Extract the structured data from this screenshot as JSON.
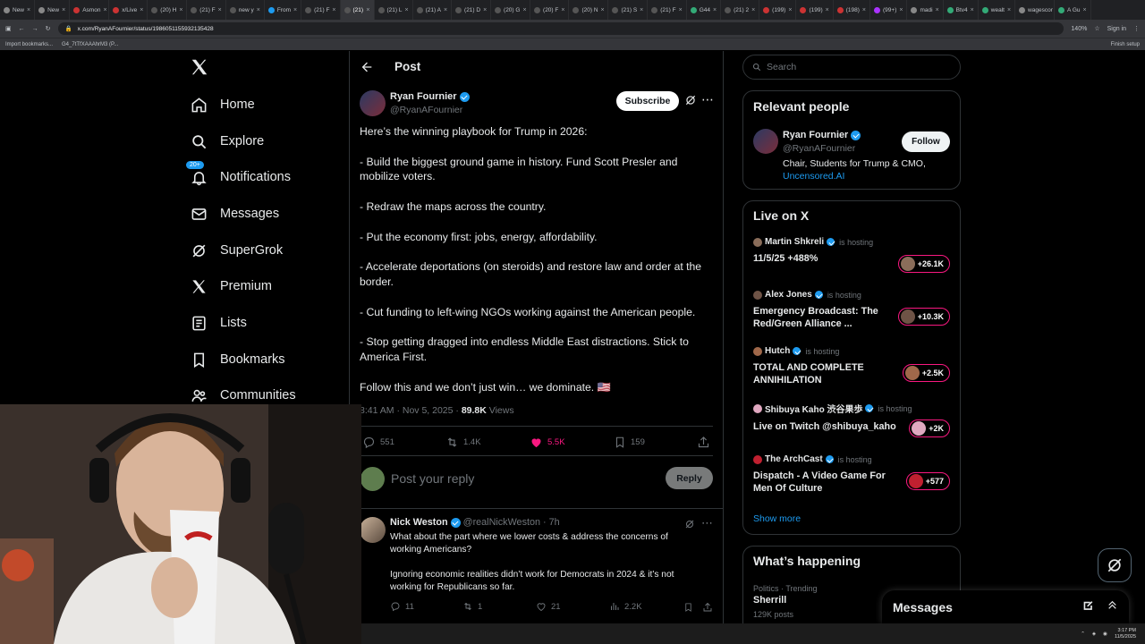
{
  "browser": {
    "tabs": [
      "New",
      "New",
      "Asmon",
      "x/Live",
      "(20) H",
      "(21) F",
      "new y",
      "From",
      "(21) F",
      "(21)",
      "(21) L",
      "(21) A",
      "(21) D",
      "(20) G",
      "(20) F",
      "(20) N",
      "(21) S",
      "(21) F",
      "G44",
      "(21) 2",
      "(199)",
      "(199)",
      "(198)",
      "(99+)",
      "madi",
      "Btv4",
      "wealt",
      "wagescor",
      "A Gu"
    ],
    "url": "x.com/RyanAFournier/status/1986051155932135428",
    "zoom": "140%",
    "signin": "Sign in",
    "bookmarks": [
      "Import bookmarks...",
      "G4_7tTfXAAAhrM3 (P..."
    ],
    "finish_setup": "Finish setup"
  },
  "nav": {
    "items": [
      {
        "label": "Home",
        "icon": "home-icon"
      },
      {
        "label": "Explore",
        "icon": "search-icon"
      },
      {
        "label": "Notifications",
        "icon": "bell-icon"
      },
      {
        "label": "Messages",
        "icon": "mail-icon"
      },
      {
        "label": "SuperGrok",
        "icon": "grok-icon"
      },
      {
        "label": "Premium",
        "icon": "x-logo-icon"
      },
      {
        "label": "Lists",
        "icon": "list-icon"
      },
      {
        "label": "Bookmarks",
        "icon": "bookmark-icon"
      },
      {
        "label": "Communities",
        "icon": "people-icon"
      }
    ],
    "notif_badge": "20+"
  },
  "post": {
    "header": "Post",
    "author_name": "Ryan Fournier",
    "author_handle": "@RyanAFournier",
    "subscribe": "Subscribe",
    "lines": [
      "Here’s the winning playbook for Trump in 2026:",
      "",
      "- Build the biggest ground game in history. Fund Scott Presler and",
      "mobilize voters.",
      "",
      "- Redraw the maps across the country.",
      "",
      "- Put the economy first: jobs, energy, affordability.",
      "",
      "- Accelerate deportations (on steroids) and restore law and order at the",
      "border.",
      "",
      "- Cut funding to left-wing NGOs working against the American people.",
      "",
      "- Stop getting dragged into endless Middle East distractions. Stick to",
      "America First.",
      "",
      "Follow this and we don’t just win… we dominate. 🇺🇸"
    ],
    "timestamp": "8:41 AM · Nov 5, 2025 ·",
    "views_count": "89.8K",
    "views_label": "Views",
    "replies": "551",
    "reposts": "1.4K",
    "likes": "5.5K",
    "bookmarks": "159",
    "reply_placeholder": "Post your reply",
    "reply_button": "Reply"
  },
  "reply_tweet": {
    "name": "Nick Weston",
    "handle": "@realNickWeston · 7h",
    "lines": [
      "What about the part where we lower costs & address the concerns of",
      "working Americans?",
      "",
      "Ignoring economic realities didn’t work for Democrats in 2024 & it’s not",
      "working for Republicans so far."
    ],
    "replies": "11",
    "reposts": "1",
    "likes": "21",
    "views": "2.2K"
  },
  "search": {
    "placeholder": "Search"
  },
  "relevant": {
    "title": "Relevant people",
    "name": "Ryan Fournier",
    "handle": "@RyanAFournier",
    "bio": "Chair, Students for Trump & CMO,",
    "bio_link": "Uncensored.AI",
    "follow": "Follow"
  },
  "live": {
    "title": "Live on X",
    "hosting": "is hosting",
    "items": [
      {
        "host": "Martin Shkreli",
        "title1": "11/5/25 +488%",
        "title2": "",
        "count": "+26.1K"
      },
      {
        "host": "Alex Jones",
        "title1": "Emergency Broadcast: The",
        "title2": "Red/Green Alliance ...",
        "count": "+10.3K"
      },
      {
        "host": "Hutch",
        "title1": "TOTAL AND COMPLETE",
        "title2": "ANNIHILATION",
        "count": "+2.5K"
      },
      {
        "host": "Shibuya Kaho 渋谷果歩",
        "title1": "Live on Twitch @shibuya_kaho",
        "title2": "",
        "count": "+2K"
      },
      {
        "host": "The ArchCast",
        "title1": "Dispatch - A Video Game For",
        "title2": "Men Of Culture",
        "count": "+577"
      }
    ],
    "show_more": "Show more"
  },
  "happening": {
    "title": "What’s happening",
    "category": "Politics · Trending",
    "topic": "Sherrill",
    "posts": "129K posts"
  },
  "messages_drawer": {
    "title": "Messages"
  },
  "taskbar": {
    "time": "3:17 PM",
    "date": "11/5/2025"
  },
  "colors": {
    "accent": "#1d9bf0",
    "like": "#f91880",
    "bg": "#000000",
    "border": "#2f3336"
  }
}
